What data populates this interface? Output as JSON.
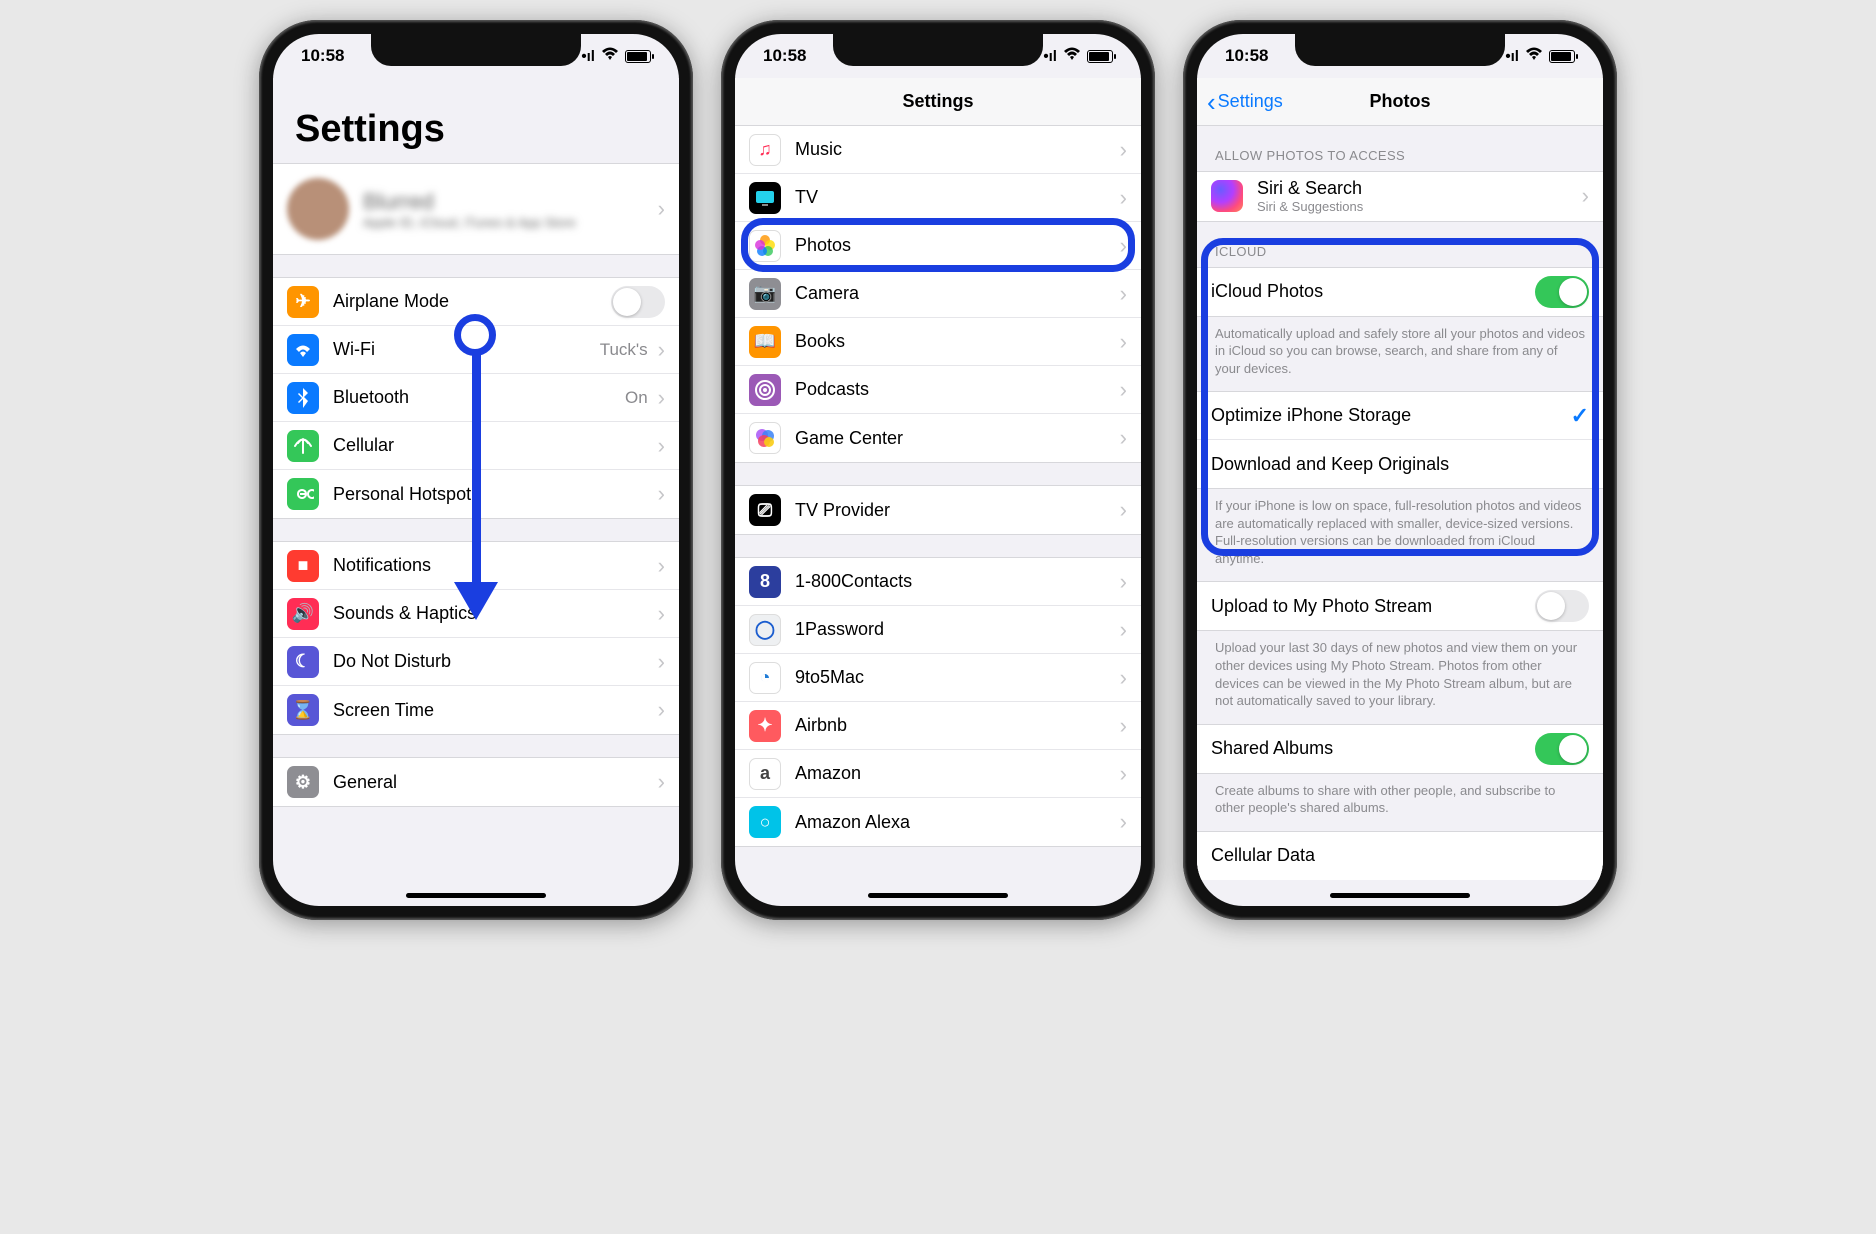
{
  "status": {
    "time": "10:58",
    "carrier_signal": "•ıl",
    "wifi": "✓",
    "battery_pct": 90
  },
  "phone1": {
    "title": "Settings",
    "profile": {
      "name": "Blurred",
      "subtitle": "Apple ID, iCloud, iTunes & App Store"
    },
    "rows_a": [
      {
        "label": "Airplane Mode",
        "icon": "✈︎",
        "bg": "#ff9500",
        "type": "toggle",
        "on": false
      },
      {
        "label": "Wi-Fi",
        "icon": "wifi",
        "bg": "#0a7aff",
        "detail": "Tuck's",
        "type": "nav"
      },
      {
        "label": "Bluetooth",
        "icon": "bt",
        "bg": "#0a7aff",
        "detail": "On",
        "type": "nav"
      },
      {
        "label": "Cellular",
        "icon": "ant",
        "bg": "#34c759",
        "type": "nav"
      },
      {
        "label": "Personal Hotspot",
        "icon": "link",
        "bg": "#34c759",
        "type": "nav"
      }
    ],
    "rows_b": [
      {
        "label": "Notifications",
        "icon": "■",
        "bg": "#ff3b30",
        "type": "nav"
      },
      {
        "label": "Sounds & Haptics",
        "icon": "🔊",
        "bg": "#ff2d55",
        "type": "nav"
      },
      {
        "label": "Do Not Disturb",
        "icon": "☾",
        "bg": "#5856d6",
        "type": "nav"
      },
      {
        "label": "Screen Time",
        "icon": "⌛",
        "bg": "#5856d6",
        "type": "nav"
      }
    ],
    "rows_c": [
      {
        "label": "General",
        "icon": "⚙",
        "bg": "#8e8e93",
        "type": "nav"
      }
    ]
  },
  "phone2": {
    "title": "Settings",
    "rows_a": [
      {
        "label": "Music",
        "icon": "♫",
        "bg": "#fff",
        "fg": "#ff2d55"
      },
      {
        "label": "TV",
        "icon": "tv",
        "bg": "#000"
      },
      {
        "label": "Photos",
        "icon": "photos",
        "bg": "#fff",
        "highlight": true
      },
      {
        "label": "Camera",
        "icon": "📷",
        "bg": "#8e8e93"
      },
      {
        "label": "Books",
        "icon": "📖",
        "bg": "#ff9500"
      },
      {
        "label": "Podcasts",
        "icon": "pod",
        "bg": "#9b59b6"
      },
      {
        "label": "Game Center",
        "icon": "gc",
        "bg": "#fff"
      }
    ],
    "rows_b": [
      {
        "label": "TV Provider",
        "icon": "⎚",
        "bg": "#000"
      }
    ],
    "rows_c": [
      {
        "label": "1-800Contacts",
        "icon": "8",
        "bg": "#2c3e9e"
      },
      {
        "label": "1Password",
        "icon": "◯",
        "bg": "#eef0f2",
        "fg": "#1b5dcf"
      },
      {
        "label": "9to5Mac",
        "icon": "◔",
        "bg": "#fff",
        "fg": "#1f7bd6"
      },
      {
        "label": "Airbnb",
        "icon": "✦",
        "bg": "#ff5a5f"
      },
      {
        "label": "Amazon",
        "icon": "a",
        "bg": "#fff",
        "fg": "#444"
      },
      {
        "label": "Amazon Alexa",
        "icon": "○",
        "bg": "#00c3e8"
      }
    ]
  },
  "phone3": {
    "back": "Settings",
    "title": "Photos",
    "header_access": "ALLOW PHOTOS TO ACCESS",
    "siri": {
      "title": "Siri & Search",
      "subtitle": "Siri & Suggestions"
    },
    "header_icloud": "ICLOUD",
    "icloud_photos": {
      "label": "iCloud Photos",
      "on": true
    },
    "icloud_desc": "Automatically upload and safely store all your photos and videos in iCloud so you can browse, search, and share from any of your devices.",
    "optimize": "Optimize iPhone Storage",
    "download": "Download and Keep Originals",
    "storage_desc": "If your iPhone is low on space, full-resolution photos and videos are automatically replaced with smaller, device-sized versions. Full-resolution versions can be downloaded from iCloud anytime.",
    "upload_stream": {
      "label": "Upload to My Photo Stream",
      "on": false
    },
    "upload_desc": "Upload your last 30 days of new photos and view them on your other devices using My Photo Stream. Photos from other devices can be viewed in the My Photo Stream album, but are not automatically saved to your library.",
    "shared": {
      "label": "Shared Albums",
      "on": true
    },
    "shared_desc": "Create albums to share with other people, and subscribe to other people's shared albums.",
    "cellular": "Cellular Data"
  }
}
